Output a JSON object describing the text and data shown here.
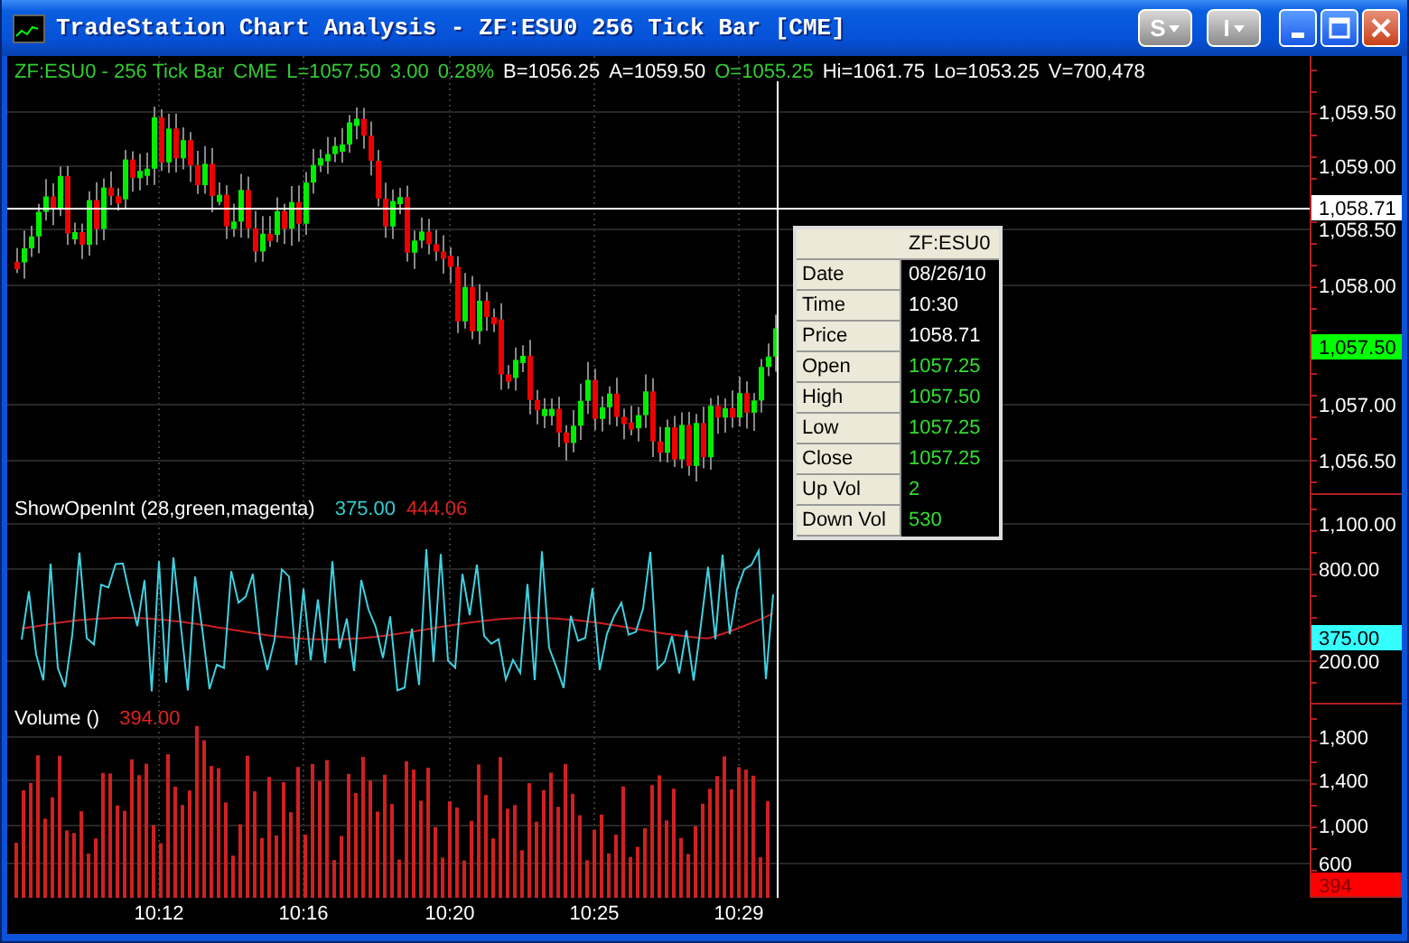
{
  "window": {
    "title": "TradeStation Chart Analysis - ZF:ESU0 256 Tick Bar [CME]",
    "menu_buttons": [
      "S",
      "I"
    ]
  },
  "price_panel": {
    "header": [
      {
        "text": "ZF:ESU0 - 256 Tick Bar",
        "color": "#33cc33"
      },
      {
        "text": "CME",
        "color": "#33cc33"
      },
      {
        "text": "L=1057.50",
        "color": "#33cc33"
      },
      {
        "text": "3.00",
        "color": "#33cc33"
      },
      {
        "text": "0.28%",
        "color": "#33cc33"
      },
      {
        "text": "B=1056.25",
        "color": "#ffffff"
      },
      {
        "text": "A=1059.50",
        "color": "#ffffff"
      },
      {
        "text": "O=1055.25",
        "color": "#33cc33"
      },
      {
        "text": "Hi=1061.75",
        "color": "#ffffff"
      },
      {
        "text": "Lo=1053.25",
        "color": "#ffffff"
      },
      {
        "text": "V=700,478",
        "color": "#ffffff"
      }
    ],
    "axis_labels": [
      "1,059.50",
      "1,059.00",
      "1,058.50",
      "1,058.00",
      "1,057.00",
      "1,056.50"
    ],
    "markers": [
      {
        "text": "1,058.71",
        "color": "#ffffff"
      },
      {
        "text": "1,057.50",
        "color": "#00ff00"
      }
    ]
  },
  "data_window": {
    "title": "ZF:ESU0",
    "rows": [
      {
        "label": "Date",
        "value": "08/26/10",
        "color": "#ffffff"
      },
      {
        "label": "Time",
        "value": "10:30",
        "color": "#ffffff"
      },
      {
        "label": "Price",
        "value": "1058.71",
        "color": "#ffffff"
      },
      {
        "label": "Open",
        "value": "1057.25",
        "color": "#33dd33"
      },
      {
        "label": "High",
        "value": "1057.50",
        "color": "#33dd33"
      },
      {
        "label": "Low",
        "value": "1057.25",
        "color": "#33dd33"
      },
      {
        "label": "Close",
        "value": "1057.25",
        "color": "#33dd33"
      },
      {
        "label": "Up Vol",
        "value": "2",
        "color": "#33dd33"
      },
      {
        "label": "Down Vol",
        "value": "530",
        "color": "#33dd33"
      }
    ]
  },
  "indicator_panel": {
    "title": "ShowOpenInt (28,green,magenta)",
    "values": [
      {
        "text": "375.00",
        "color": "#33cccc"
      },
      {
        "text": "444.06",
        "color": "#dd2222"
      }
    ],
    "axis_labels": [
      "1,100.00",
      "800.00",
      "200.00"
    ],
    "markers": [
      {
        "text": "375.00",
        "color": "#33ffff"
      }
    ]
  },
  "volume_panel": {
    "title": "Volume ()",
    "values": [
      {
        "text": "394.00",
        "color": "#dd2222"
      }
    ],
    "axis_labels": [
      "1,800",
      "1,400",
      "1,000",
      "600"
    ],
    "markers": [
      {
        "text": "394",
        "color": "#ff0000"
      }
    ]
  },
  "time_axis": [
    "10:12",
    "10:16",
    "10:20",
    "10:25",
    "10:29"
  ]
}
